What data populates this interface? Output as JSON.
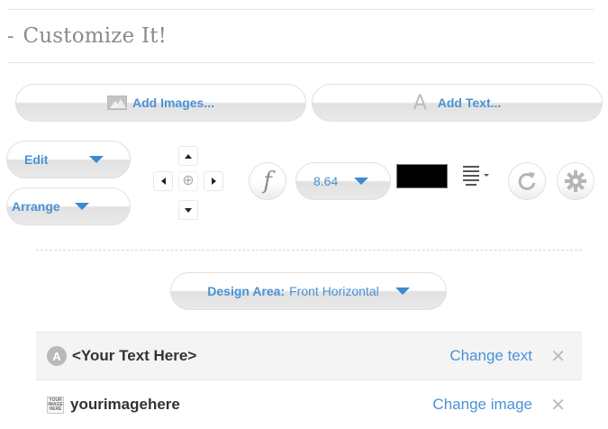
{
  "section": {
    "collapse_symbol": "-",
    "title": "Customize It!"
  },
  "toolbar": {
    "add_images_label": "Add Images...",
    "add_text_label": "Add Text...",
    "edit_label": "Edit",
    "arrange_label": "Arrange",
    "font_size_value": "8.64",
    "font_icon_glyph": "f",
    "text_color": "#000000",
    "accent_color": "#4a92d6"
  },
  "nudge_pad": {
    "center_glyph": "⊕"
  },
  "design_area": {
    "label": "Design Area:",
    "value": "Front Horizontal"
  },
  "elements": [
    {
      "type": "text",
      "icon": "letter-a-badge-icon",
      "badge_letter": "A",
      "name": "<Your Text Here>",
      "action_label": "Change text",
      "remove_glyph": "✕"
    },
    {
      "type": "image",
      "icon": "image-thumbnail-icon",
      "thumb_text": [
        "YOUR",
        "IMAGE",
        "HERE"
      ],
      "name": "yourimagehere",
      "action_label": "Change image",
      "remove_glyph": "✕"
    }
  ]
}
